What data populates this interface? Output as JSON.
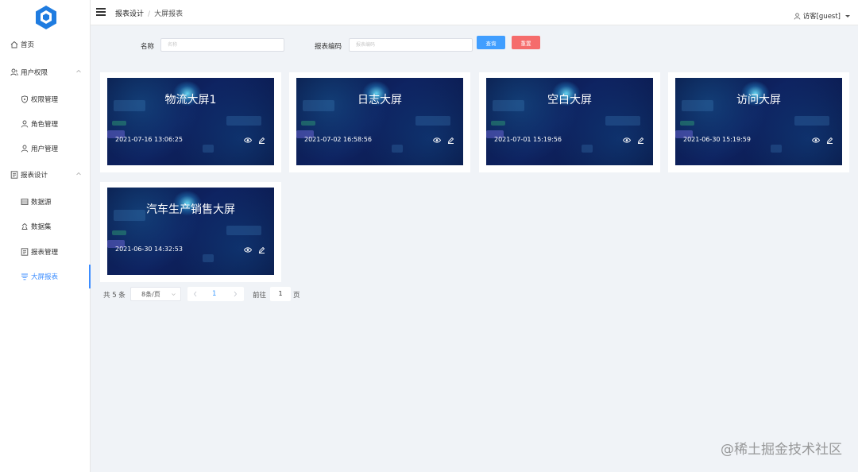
{
  "sidebar": {
    "items": [
      {
        "label": "首页",
        "icon": "home-icon"
      },
      {
        "label": "用户权限",
        "icon": "user-group-icon"
      },
      {
        "label": "权限管理",
        "icon": "shield-icon"
      },
      {
        "label": "角色管理",
        "icon": "role-icon"
      },
      {
        "label": "用户管理",
        "icon": "user-icon"
      },
      {
        "label": "报表设计",
        "icon": "report-design-icon"
      },
      {
        "label": "数据源",
        "icon": "datasource-icon"
      },
      {
        "label": "数据集",
        "icon": "dataset-icon"
      },
      {
        "label": "报表管理",
        "icon": "report-manage-icon"
      },
      {
        "label": "大屏报表",
        "icon": "screen-report-icon"
      }
    ],
    "active_color": "#3c8dff"
  },
  "header": {
    "breadcrumb_parent": "报表设计",
    "breadcrumb_separator": "/",
    "breadcrumb_current": "大屏报表",
    "user_label": "访客[guest]"
  },
  "search": {
    "name_label": "名称",
    "name_placeholder": "名称",
    "code_label": "报表编码",
    "code_placeholder": "报表编码",
    "query_button": "查询",
    "reset_button": "重置"
  },
  "cards": [
    {
      "title": "物流大屏1",
      "time": "2021-07-16 13:06:25"
    },
    {
      "title": "日志大屏",
      "time": "2021-07-02 16:58:56"
    },
    {
      "title": "空白大屏",
      "time": "2021-07-01 15:19:56"
    },
    {
      "title": "访问大屏",
      "time": "2021-06-30 15:19:59"
    },
    {
      "title": "汽车生产销售大屏",
      "time": "2021-06-30 14:32:53"
    }
  ],
  "pagination": {
    "total_text": "共 5 条",
    "page_size": "8条/页",
    "current_page": "1",
    "goto_label": "前往",
    "goto_value": "1",
    "page_suffix": "页"
  },
  "watermark": "@稀土掘金技术社区",
  "colors": {
    "primary": "#409eff",
    "danger": "#f56c6c",
    "background": "#f0f3f7"
  }
}
